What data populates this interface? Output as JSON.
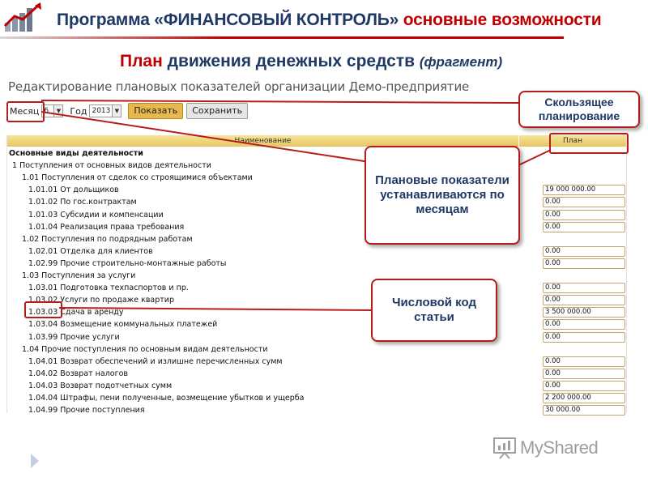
{
  "slide": {
    "title_part1": "Программа «ФИНАНСОВЫЙ КОНТРОЛЬ»",
    "title_part2": "основные возможности",
    "subtitle_part1": "План",
    "subtitle_part2": "движения денежных средств",
    "subtitle_note": "(фрагмент)"
  },
  "app": {
    "page_heading": "Редактирование плановых показателей организации Демо-предприятие",
    "toolbar": {
      "month_label": "Месяц",
      "month_value": "6",
      "year_label": "Год",
      "year_value": "2013",
      "show_button": "Показать",
      "save_button": "Сохранить"
    },
    "table": {
      "columns": [
        "Наименование",
        "План"
      ],
      "rows": [
        {
          "name": "Основные виды деятельности",
          "level": 0,
          "bold": true,
          "value": null
        },
        {
          "name": "1 Поступления от основных видов деятельности",
          "level": 1,
          "value": null
        },
        {
          "name": "1.01 Поступления от сделок со строящимися объектами",
          "level": 2,
          "value": null
        },
        {
          "name": "1.01.01 От дольщиков",
          "level": 3,
          "value": "19 000 000.00"
        },
        {
          "name": "1.01.02 По гос.контрактам",
          "level": 3,
          "value": "0.00"
        },
        {
          "name": "1.01.03 Субсидии и компенсации",
          "level": 3,
          "value": "0.00"
        },
        {
          "name": "1.01.04 Реализация права требования",
          "level": 3,
          "value": "0.00"
        },
        {
          "name": "1.02 Поступления по подрядным работам",
          "level": 2,
          "value": null
        },
        {
          "name": "1.02.01 Отделка для клиентов",
          "level": 3,
          "value": "0.00"
        },
        {
          "name": "1.02.99 Прочие строительно-монтажные работы",
          "level": 3,
          "value": "0.00"
        },
        {
          "name": "1.03 Поступления за услуги",
          "level": 2,
          "value": null
        },
        {
          "name": "1.03.01 Подготовка техпаспортов и пр.",
          "level": 3,
          "value": "0.00"
        },
        {
          "name": "1.03.02 Услуги по продаже квартир",
          "level": 3,
          "value": "0.00"
        },
        {
          "name": "1.03.03 Сдача в аренду",
          "level": 3,
          "value": "3 500 000.00"
        },
        {
          "name": "1.03.04 Возмещение коммунальных платежей",
          "level": 3,
          "value": "0.00"
        },
        {
          "name": "1.03.99 Прочие услуги",
          "level": 3,
          "value": "0.00"
        },
        {
          "name": "1.04 Прочие поступления по основным видам деятельности",
          "level": 2,
          "value": null
        },
        {
          "name": "1.04.01 Возврат обеспечений и излишне перечисленных сумм",
          "level": 3,
          "value": "0.00"
        },
        {
          "name": "1.04.02 Возврат налогов",
          "level": 3,
          "value": "0.00"
        },
        {
          "name": "1.04.03 Возврат подотчетных сумм",
          "level": 3,
          "value": "0.00"
        },
        {
          "name": "1.04.04 Штрафы, пени полученные, возмещение убытков и ущерба",
          "level": 3,
          "value": "2 200 000.00"
        },
        {
          "name": "1.04.99 Прочие поступления",
          "level": 3,
          "value": "30 000.00"
        }
      ]
    }
  },
  "callouts": {
    "sliding": "Скользящее планирование",
    "monthly": "Плановые показатели устанавливаются по месяцам",
    "code": "Числовой код статьи"
  },
  "watermark": "MyShared",
  "colors": {
    "accent_red": "#b71c1c",
    "title_blue": "#1f3864",
    "header_gold": "#e6c661"
  }
}
